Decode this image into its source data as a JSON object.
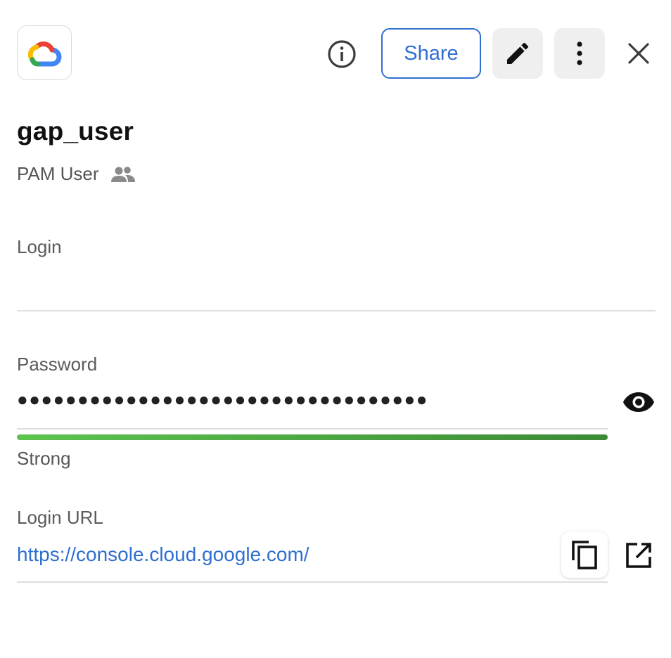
{
  "record": {
    "title": "gap_user",
    "type_label": "PAM User"
  },
  "header": {
    "share_label": "Share",
    "logo_icon": "google-cloud-logo",
    "info_icon": "info-icon",
    "edit_icon": "pencil-icon",
    "more_icon": "more-vertical-icon",
    "close_icon": "close-icon"
  },
  "fields": {
    "login": {
      "label": "Login",
      "value": ""
    },
    "password": {
      "label": "Password",
      "masked_value": "●●●●●●●●●●●●●●●●●●●●●●●●●●●●●●●●●●",
      "strength": "Strong",
      "strength_fraction": 1.0,
      "reveal_icon": "eye-icon"
    },
    "login_url": {
      "label": "Login URL",
      "value": "https://console.cloud.google.com/",
      "copy_icon": "copy-icon",
      "open_icon": "open-external-icon"
    }
  },
  "colors": {
    "accent": "#2f6fcf",
    "strength_start": "#5cc44f",
    "strength_end": "#3c8a35",
    "button_bg": "#efefef"
  }
}
